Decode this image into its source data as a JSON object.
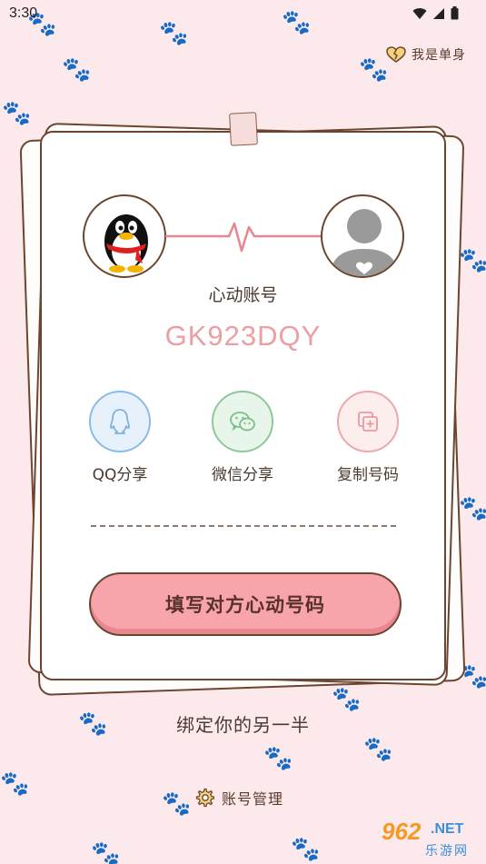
{
  "status_bar": {
    "time": "3:30"
  },
  "header": {
    "single_label": "我是单身"
  },
  "card": {
    "account_label": "心动账号",
    "account_code": "GK923DQY",
    "share": [
      {
        "label": "QQ分享",
        "icon": "qq-icon"
      },
      {
        "label": "微信分享",
        "icon": "wechat-icon"
      },
      {
        "label": "复制号码",
        "icon": "copy-icon"
      }
    ],
    "fill_button_label": "填写对方心动号码"
  },
  "bind_text": "绑定你的另一半",
  "footer": {
    "manage_label": "账号管理"
  },
  "watermark": {
    "number": "962",
    "suffix": ".NET",
    "text": "乐游网"
  },
  "colors": {
    "background": "#fbe9ec",
    "accent_pink": "#f7a5ab",
    "code_pink": "#ec9ea3",
    "border_brown": "#6b4530"
  }
}
